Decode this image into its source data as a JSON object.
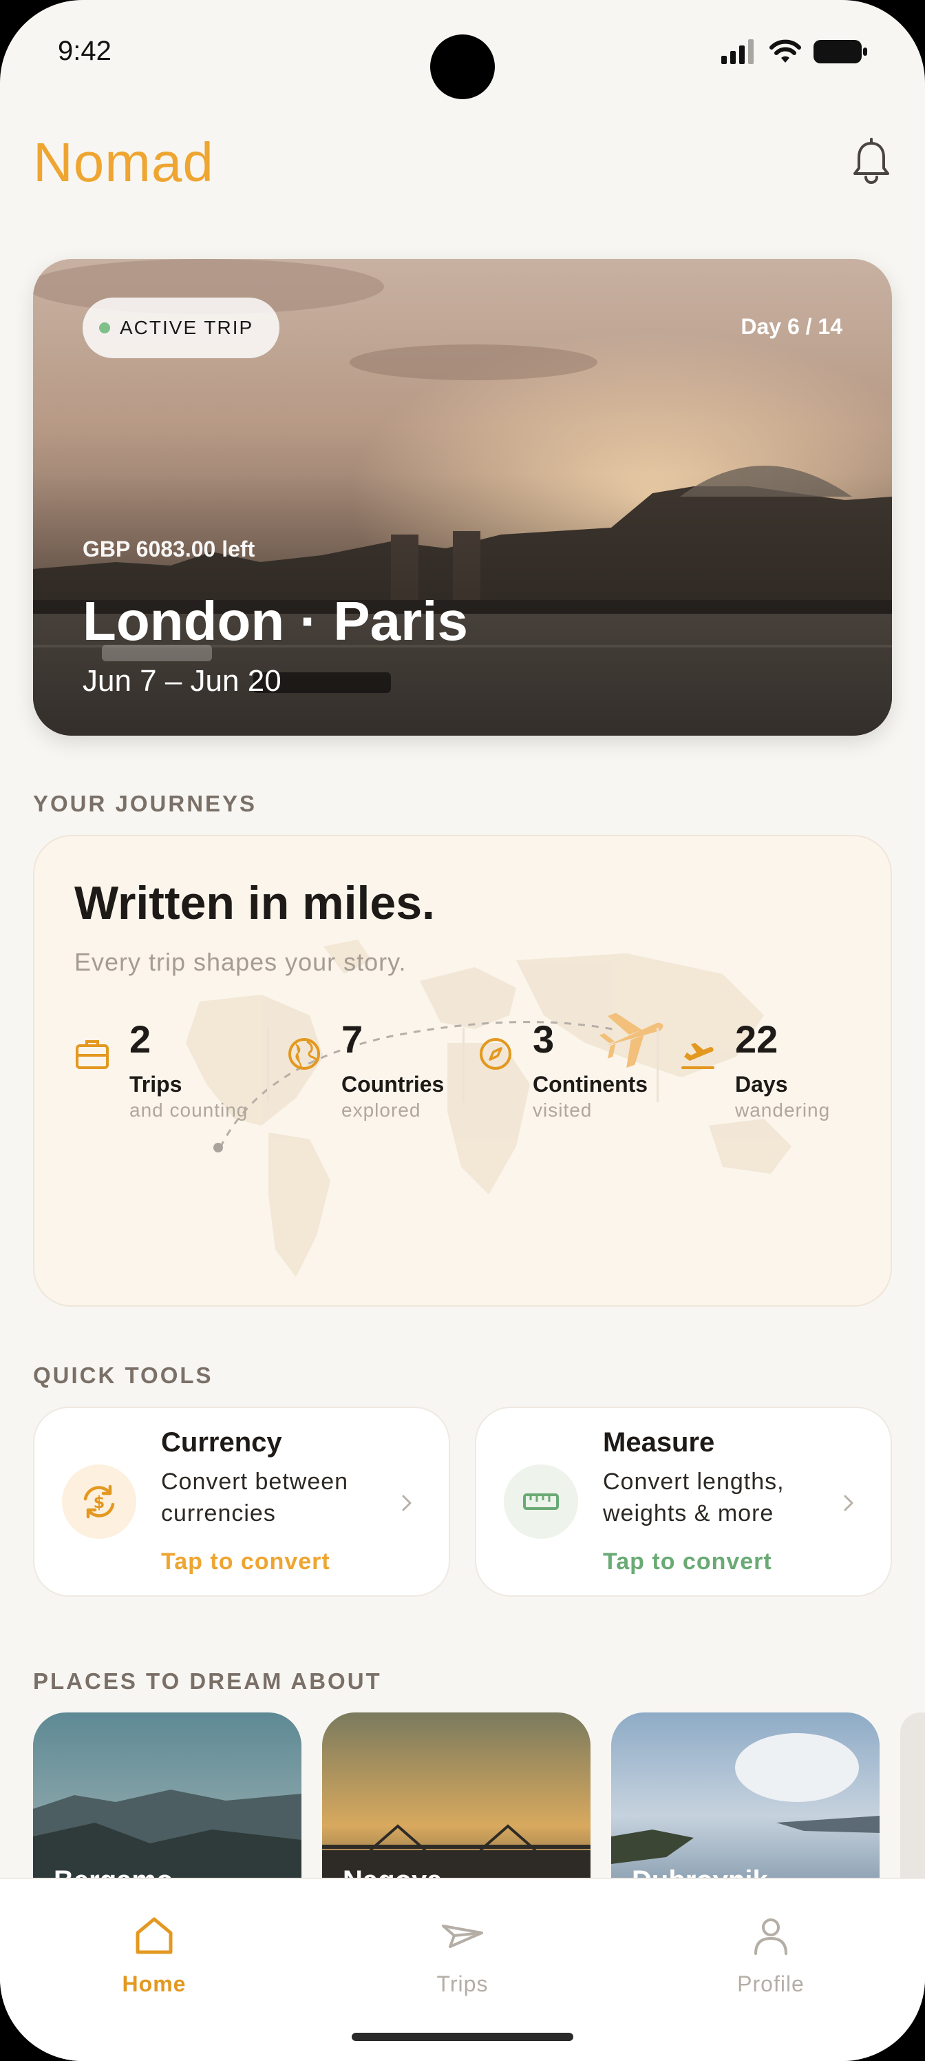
{
  "status_bar": {
    "time": "9:42"
  },
  "header": {
    "title": "Nomad"
  },
  "hero": {
    "badge": "ACTIVE TRIP",
    "day_progress": "Day 6 / 14",
    "budget": "GBP 6083.00 left",
    "title": "London · Paris",
    "dates": "Jun 7 – Jun 20"
  },
  "journeys": {
    "section_label": "YOUR JOURNEYS",
    "title": "Written in miles.",
    "subtitle": "Every trip shapes your story.",
    "stats": [
      {
        "value": "2",
        "label": "Trips",
        "sub": "and counting",
        "icon": "briefcase-icon"
      },
      {
        "value": "7",
        "label": "Countries",
        "sub": "explored",
        "icon": "globe-icon"
      },
      {
        "value": "3",
        "label": "Continents",
        "sub": "visited",
        "icon": "compass-icon"
      },
      {
        "value": "22",
        "label": "Days",
        "sub": "wandering",
        "icon": "plane-takeoff-icon"
      }
    ]
  },
  "tools": {
    "section_label": "QUICK TOOLS",
    "items": [
      {
        "title": "Currency",
        "description": "Convert between currencies",
        "cta": "Tap to convert",
        "icon": "currency-exchange-icon",
        "accent": "#e49a22"
      },
      {
        "title": "Measure",
        "description": "Convert lengths, weights & more",
        "cta": "Tap to convert",
        "icon": "ruler-icon",
        "accent": "#6aaa74"
      }
    ]
  },
  "places": {
    "section_label": "PLACES TO DREAM ABOUT",
    "items": [
      {
        "name": "Bergamo"
      },
      {
        "name": "Nagoya"
      },
      {
        "name": "Dubrovnik"
      }
    ]
  },
  "nav": {
    "items": [
      {
        "label": "Home",
        "icon": "home-icon",
        "active": true
      },
      {
        "label": "Trips",
        "icon": "paper-plane-icon",
        "active": false
      },
      {
        "label": "Profile",
        "icon": "user-icon",
        "active": false
      }
    ]
  },
  "colors": {
    "accent": "#eea531",
    "green": "#6aaa74",
    "background": "#f8f6f2"
  }
}
